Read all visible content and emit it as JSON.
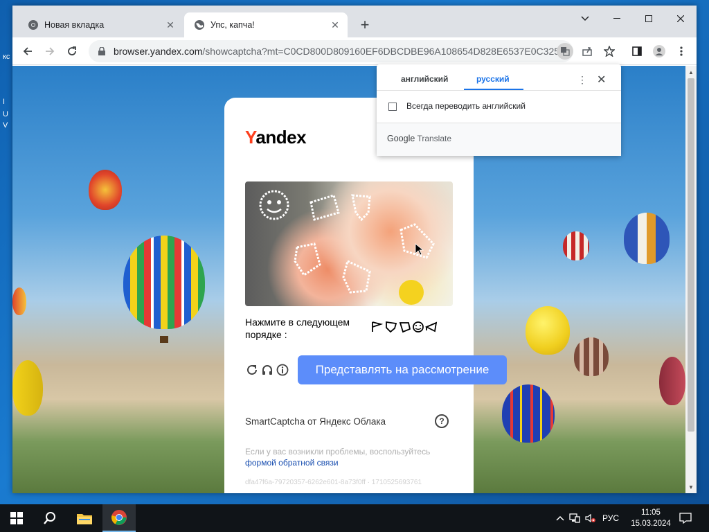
{
  "desktop": {
    "side_text_1": "кс",
    "side_text_2": "I",
    "side_text_3": "U",
    "side_text_4": "V"
  },
  "browser": {
    "tabs": [
      {
        "label": "Новая вкладка",
        "icon": "chrome-icon",
        "active": false
      },
      {
        "label": "Упс, капча!",
        "icon": "globe-icon",
        "active": true
      }
    ],
    "url_host": "browser.yandex.com",
    "url_path": "/showcaptcha?mt=C0CD800D809160EF6DBCDBE96A108654D828E6537E0C3259..."
  },
  "translate_popup": {
    "lang_source": "английский",
    "lang_target": "русский",
    "always_translate_label": "Всегда переводить английский",
    "brand_google": "Google",
    "brand_translate": "Translate"
  },
  "captcha": {
    "logo_y": "Y",
    "logo_rest": "andex",
    "instruction": "Нажмите в следующем порядке :",
    "instruction_glyphs": "⚐⊿⊿☺◁",
    "submit_label": "Представлять на рассмотрение",
    "smartcaptcha_label": "SmartCaptcha от Яндекс Облака",
    "help_glyph": "?",
    "problem_text": "Если у вас возникли проблемы, воспользуйтесь",
    "feedback_link": "формой обратной связи",
    "request_id": "dfa47f6a-79720357-6262e601-8a73f0ff · 1710525693761"
  },
  "taskbar": {
    "lang": "РУС",
    "time": "11:05",
    "date": "15.03.2024"
  },
  "colors": {
    "accent": "#1a73e8",
    "submit_button": "#5c8dfa",
    "yandex_red": "#fc3f1d"
  }
}
